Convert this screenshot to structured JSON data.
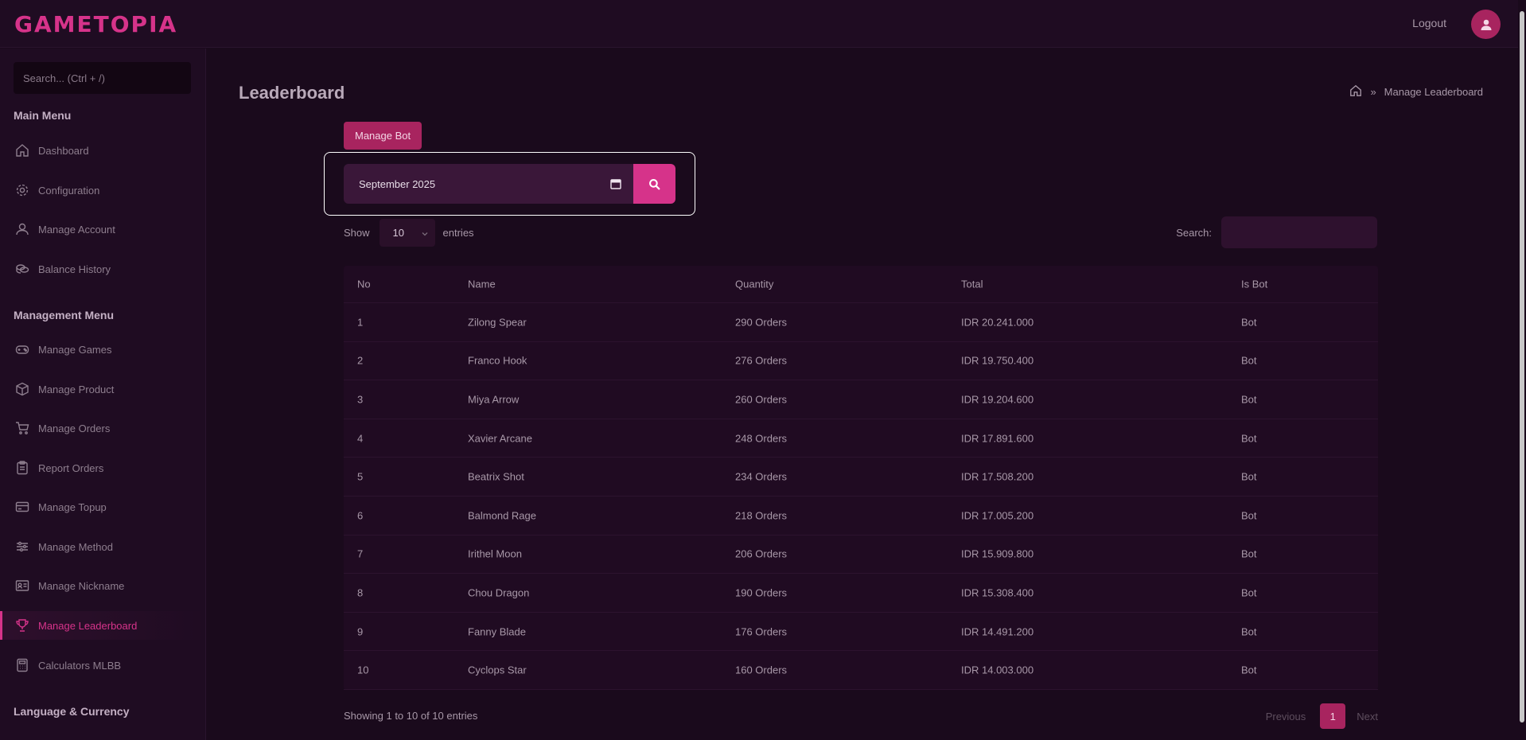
{
  "app": {
    "logo": "GAMETOPIA",
    "logout_label": "Logout"
  },
  "sidebar": {
    "search_placeholder": "Search... (Ctrl + /)",
    "main_menu_heading": "Main Menu",
    "main_items": [
      {
        "label": "Dashboard",
        "icon": "home-icon"
      },
      {
        "label": "Configuration",
        "icon": "gear-icon"
      },
      {
        "label": "Manage Account",
        "icon": "user-icon"
      },
      {
        "label": "Balance History",
        "icon": "coins-icon"
      }
    ],
    "management_heading": "Management Menu",
    "management_items": [
      {
        "label": "Manage Games",
        "icon": "gamepad-icon"
      },
      {
        "label": "Manage Product",
        "icon": "box-icon"
      },
      {
        "label": "Manage Orders",
        "icon": "cart-icon"
      },
      {
        "label": "Report Orders",
        "icon": "clipboard-icon"
      },
      {
        "label": "Manage Topup",
        "icon": "card-icon"
      },
      {
        "label": "Manage Method",
        "icon": "sliders-icon"
      },
      {
        "label": "Manage Nickname",
        "icon": "id-card-icon"
      },
      {
        "label": "Manage Leaderboard",
        "icon": "trophy-icon",
        "active": true
      },
      {
        "label": "Calculators MLBB",
        "icon": "calculator-icon"
      }
    ],
    "language_heading": "Language & Currency"
  },
  "page": {
    "title": "Leaderboard",
    "breadcrumb_current": "Manage Leaderboard",
    "manage_bot_label": "Manage Bot",
    "date_value": "September 2025",
    "show_label": "Show",
    "entries_count": "10",
    "entries_label": "entries",
    "search_label": "Search:"
  },
  "table": {
    "headers": [
      "No",
      "Name",
      "Quantity",
      "Total",
      "Is Bot"
    ],
    "rows": [
      [
        "1",
        "Zilong Spear",
        "290 Orders",
        "IDR 20.241.000",
        "Bot"
      ],
      [
        "2",
        "Franco Hook",
        "276 Orders",
        "IDR 19.750.400",
        "Bot"
      ],
      [
        "3",
        "Miya Arrow",
        "260 Orders",
        "IDR 19.204.600",
        "Bot"
      ],
      [
        "4",
        "Xavier Arcane",
        "248 Orders",
        "IDR 17.891.600",
        "Bot"
      ],
      [
        "5",
        "Beatrix Shot",
        "234 Orders",
        "IDR 17.508.200",
        "Bot"
      ],
      [
        "6",
        "Balmond Rage",
        "218 Orders",
        "IDR 17.005.200",
        "Bot"
      ],
      [
        "7",
        "Irithel Moon",
        "206 Orders",
        "IDR 15.909.800",
        "Bot"
      ],
      [
        "8",
        "Chou Dragon",
        "190 Orders",
        "IDR 15.308.400",
        "Bot"
      ],
      [
        "9",
        "Fanny Blade",
        "176 Orders",
        "IDR 14.491.200",
        "Bot"
      ],
      [
        "10",
        "Cyclops Star",
        "160 Orders",
        "IDR 14.003.000",
        "Bot"
      ]
    ],
    "info": "Showing 1 to 10 of 10 entries",
    "pager": {
      "previous": "Previous",
      "page": "1",
      "next": "Next"
    }
  },
  "colors": {
    "accent": "#d6338a",
    "button": "#a8245f",
    "background": "#1a0a1c"
  }
}
